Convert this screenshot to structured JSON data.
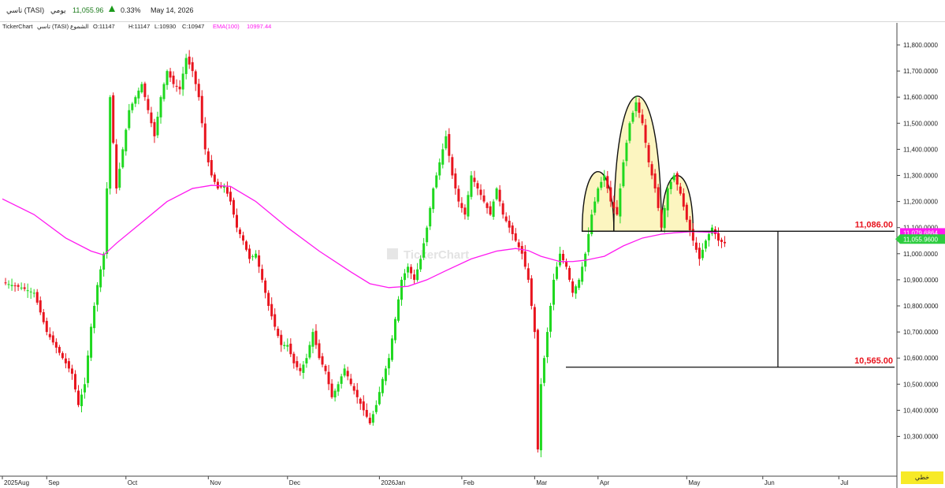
{
  "header": {
    "symbol": "تاسي (TASI)",
    "period": "يومي",
    "price": "11,055.96",
    "change_arrow_icon": "triangle-up-icon",
    "change_pct": "0.33%",
    "date": "May 14, 2026"
  },
  "info": {
    "brand": "TickerChart",
    "instrument": "تاسي (TASI)",
    "chart_kind": "الشموع",
    "open": "O:11147",
    "high": "H:11147",
    "low": "L:10930",
    "close": "C:10947",
    "ema_label": "EMA(100)",
    "ema_value": "10997.44"
  },
  "watermark": "TickerChart",
  "draw_button": "خطي",
  "colors": {
    "up": "#1fd81f",
    "down": "#e8141e",
    "ema": "#ff19f0",
    "pattern_fill": "#fbf3b5",
    "level_label": "#e8141e",
    "price_tag": "#2ecc40",
    "ema_tag": "#ff19f0"
  },
  "chart_data": {
    "type": "candlestick",
    "y_ticks": [
      "11,800.0000",
      "11,700.0000",
      "11,600.0000",
      "11,500.0000",
      "11,400.0000",
      "11,300.0000",
      "11,200.0000",
      "11,100.0000",
      "11,000.0000",
      "10,900.0000",
      "10,800.0000",
      "10,700.0000",
      "10,600.0000",
      "10,500.0000",
      "10,400.0000",
      "10,300.0000"
    ],
    "y_tick_values": [
      11800,
      11700,
      11600,
      11500,
      11400,
      11300,
      11200,
      11100,
      11000,
      10900,
      10800,
      10700,
      10600,
      10500,
      10400,
      10300
    ],
    "x_labels": [
      "2025Aug",
      "Sep",
      "Oct",
      "Nov",
      "Dec",
      "2026Jan",
      "Feb",
      "Mar",
      "Apr",
      "May",
      "Jun",
      "Jul"
    ],
    "ema_label": "EMA(100)",
    "price_tag": "11,055.9600",
    "ema_tag": "11,079.6864",
    "levels": [
      {
        "label": "11,086.00",
        "value": 11086
      },
      {
        "label": "10,565.00",
        "value": 10565
      }
    ],
    "pattern": "head-and-shoulders",
    "series_close_anchors": [
      [
        0,
        10890
      ],
      [
        6,
        10870
      ],
      [
        10,
        10850
      ],
      [
        14,
        10700
      ],
      [
        18,
        10620
      ],
      [
        22,
        10540
      ],
      [
        24,
        10420
      ],
      [
        26,
        10500
      ],
      [
        28,
        10720
      ],
      [
        30,
        10880
      ],
      [
        32,
        11000
      ],
      [
        33,
        11250
      ],
      [
        34,
        11600
      ],
      [
        36,
        11250
      ],
      [
        38,
        11400
      ],
      [
        40,
        11550
      ],
      [
        42,
        11600
      ],
      [
        44,
        11650
      ],
      [
        46,
        11550
      ],
      [
        48,
        11450
      ],
      [
        50,
        11600
      ],
      [
        52,
        11700
      ],
      [
        54,
        11650
      ],
      [
        56,
        11630
      ],
      [
        58,
        11750
      ],
      [
        60,
        11700
      ],
      [
        62,
        11600
      ],
      [
        64,
        11400
      ],
      [
        66,
        11300
      ],
      [
        68,
        11250
      ],
      [
        70,
        11260
      ],
      [
        72,
        11200
      ],
      [
        74,
        11100
      ],
      [
        76,
        11050
      ],
      [
        78,
        10980
      ],
      [
        80,
        11000
      ],
      [
        82,
        10900
      ],
      [
        84,
        10800
      ],
      [
        86,
        10720
      ],
      [
        88,
        10650
      ],
      [
        90,
        10650
      ],
      [
        92,
        10580
      ],
      [
        94,
        10550
      ],
      [
        96,
        10600
      ],
      [
        98,
        10700
      ],
      [
        100,
        10600
      ],
      [
        102,
        10550
      ],
      [
        104,
        10450
      ],
      [
        106,
        10500
      ],
      [
        108,
        10560
      ],
      [
        110,
        10500
      ],
      [
        112,
        10450
      ],
      [
        114,
        10400
      ],
      [
        116,
        10350
      ],
      [
        118,
        10420
      ],
      [
        120,
        10520
      ],
      [
        122,
        10600
      ],
      [
        124,
        10750
      ],
      [
        126,
        10900
      ],
      [
        128,
        10950
      ],
      [
        130,
        10900
      ],
      [
        132,
        10980
      ],
      [
        134,
        11100
      ],
      [
        136,
        11250
      ],
      [
        138,
        11350
      ],
      [
        140,
        11450
      ],
      [
        142,
        11300
      ],
      [
        144,
        11200
      ],
      [
        146,
        11150
      ],
      [
        148,
        11300
      ],
      [
        150,
        11250
      ],
      [
        152,
        11200
      ],
      [
        154,
        11150
      ],
      [
        156,
        11250
      ],
      [
        158,
        11150
      ],
      [
        160,
        11100
      ],
      [
        162,
        11050
      ],
      [
        164,
        11000
      ],
      [
        166,
        10900
      ],
      [
        168,
        10700
      ],
      [
        169,
        10250
      ],
      [
        170,
        10500
      ],
      [
        172,
        10700
      ],
      [
        174,
        10900
      ],
      [
        176,
        11000
      ],
      [
        178,
        10950
      ],
      [
        180,
        10850
      ],
      [
        182,
        10900
      ],
      [
        184,
        11000
      ],
      [
        186,
        11150
      ],
      [
        188,
        11250
      ],
      [
        190,
        11300
      ],
      [
        192,
        11200
      ],
      [
        194,
        11150
      ],
      [
        196,
        11350
      ],
      [
        198,
        11500
      ],
      [
        200,
        11580
      ],
      [
        202,
        11500
      ],
      [
        204,
        11350
      ],
      [
        206,
        11250
      ],
      [
        208,
        11100
      ],
      [
        210,
        11250
      ],
      [
        212,
        11300
      ],
      [
        214,
        11230
      ],
      [
        216,
        11130
      ],
      [
        218,
        11050
      ],
      [
        220,
        10980
      ],
      [
        222,
        11050
      ],
      [
        224,
        11100
      ],
      [
        226,
        11050
      ],
      [
        228,
        11040
      ]
    ],
    "ema_anchors": [
      [
        0,
        11210
      ],
      [
        10,
        11150
      ],
      [
        20,
        11060
      ],
      [
        28,
        11010
      ],
      [
        32,
        10995
      ],
      [
        36,
        11040
      ],
      [
        44,
        11120
      ],
      [
        52,
        11200
      ],
      [
        60,
        11250
      ],
      [
        66,
        11262
      ],
      [
        72,
        11258
      ],
      [
        80,
        11200
      ],
      [
        90,
        11100
      ],
      [
        100,
        11010
      ],
      [
        110,
        10930
      ],
      [
        116,
        10885
      ],
      [
        122,
        10870
      ],
      [
        128,
        10875
      ],
      [
        134,
        10900
      ],
      [
        140,
        10935
      ],
      [
        148,
        10980
      ],
      [
        156,
        11010
      ],
      [
        162,
        11020
      ],
      [
        166,
        11012
      ],
      [
        170,
        10990
      ],
      [
        176,
        10970
      ],
      [
        180,
        10970
      ],
      [
        184,
        10975
      ],
      [
        190,
        10990
      ],
      [
        196,
        11030
      ],
      [
        202,
        11060
      ],
      [
        208,
        11075
      ],
      [
        212,
        11080
      ],
      [
        218,
        11085
      ],
      [
        226,
        11080
      ]
    ]
  }
}
